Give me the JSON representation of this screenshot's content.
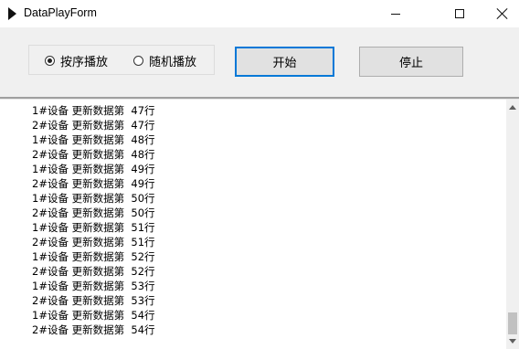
{
  "window": {
    "title": "DataPlayForm",
    "icon": "play-triangle-icon"
  },
  "controls": {
    "radio_sequential_label": "按序播放",
    "radio_random_label": "随机播放",
    "selected_mode": "按序播放",
    "start_label": "开始",
    "stop_label": "停止"
  },
  "log": {
    "lines": [
      "1#设备 更新数据第  47行",
      "2#设备 更新数据第  47行",
      "1#设备 更新数据第  48行",
      "2#设备 更新数据第  48行",
      "1#设备 更新数据第  49行",
      "2#设备 更新数据第  49行",
      "1#设备 更新数据第  50行",
      "2#设备 更新数据第  50行",
      "1#设备 更新数据第  51行",
      "2#设备 更新数据第  51行",
      "1#设备 更新数据第  52行",
      "2#设备 更新数据第  52行",
      "1#设备 更新数据第  53行",
      "2#设备 更新数据第  53行",
      "1#设备 更新数据第  54行",
      "2#设备 更新数据第  54行"
    ]
  },
  "colors": {
    "panel_bg": "#f0f0f0",
    "button_bg": "#e1e1e1",
    "focus_border": "#0078d7"
  }
}
